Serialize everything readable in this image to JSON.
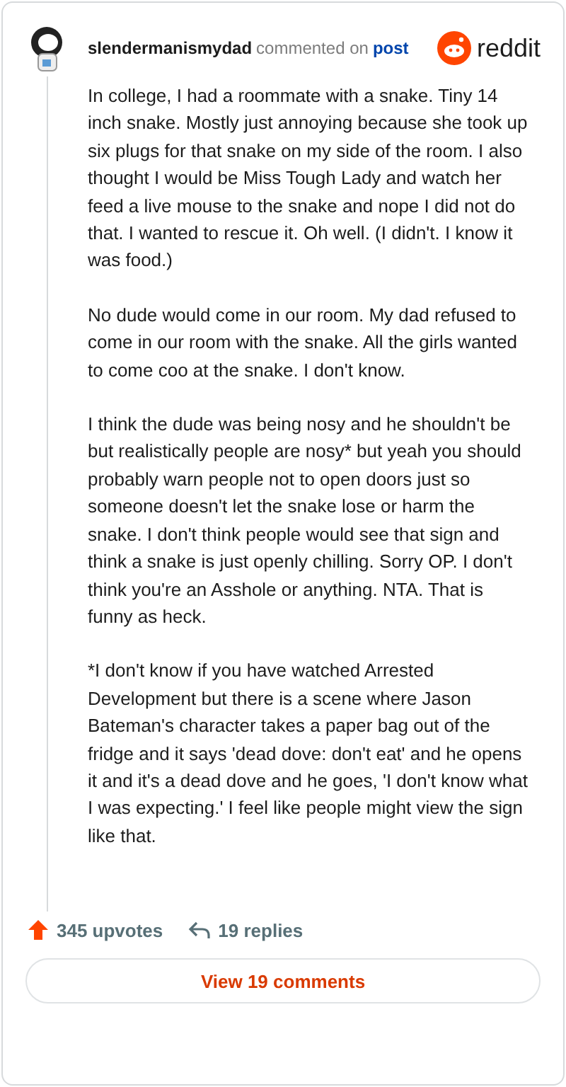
{
  "header": {
    "username": "slendermanismydad",
    "action": "commented on",
    "link": "post",
    "brand": "reddit"
  },
  "paragraphs": [
    "In college, I had a roommate with a snake. Tiny 14 inch snake. Mostly just annoying because she took up six plugs for that snake on my side of the room. I also thought I would be Miss Tough Lady and watch her feed a live mouse to the snake and nope I did not do that. I wanted to rescue it. Oh well. (I didn't. I know it was food.)",
    "No dude would come in our room. My dad refused to come in our room with the snake. All the girls wanted to come coo at the snake. I don't know.",
    "I think the dude was being nosy and he shouldn't be but realistically people are nosy* but yeah you should probably warn people not to open doors just so someone doesn't let the snake lose or harm the snake. I don't think people would see that sign and think a snake is just openly chilling. Sorry OP. I don't think you're an Asshole or anything. NTA. That is funny as heck.",
    "*I don't know if you have watched Arrested Development but there is a scene where Jason Bateman's character takes a paper bag out of the fridge and it says 'dead dove: don't eat' and he opens it and it's a dead dove and he goes, 'I don't know what I was expecting.' I feel like people might view the sign like that."
  ],
  "footer": {
    "upvotes": "345 upvotes",
    "replies": "19 replies",
    "button": "View 19 comments"
  }
}
